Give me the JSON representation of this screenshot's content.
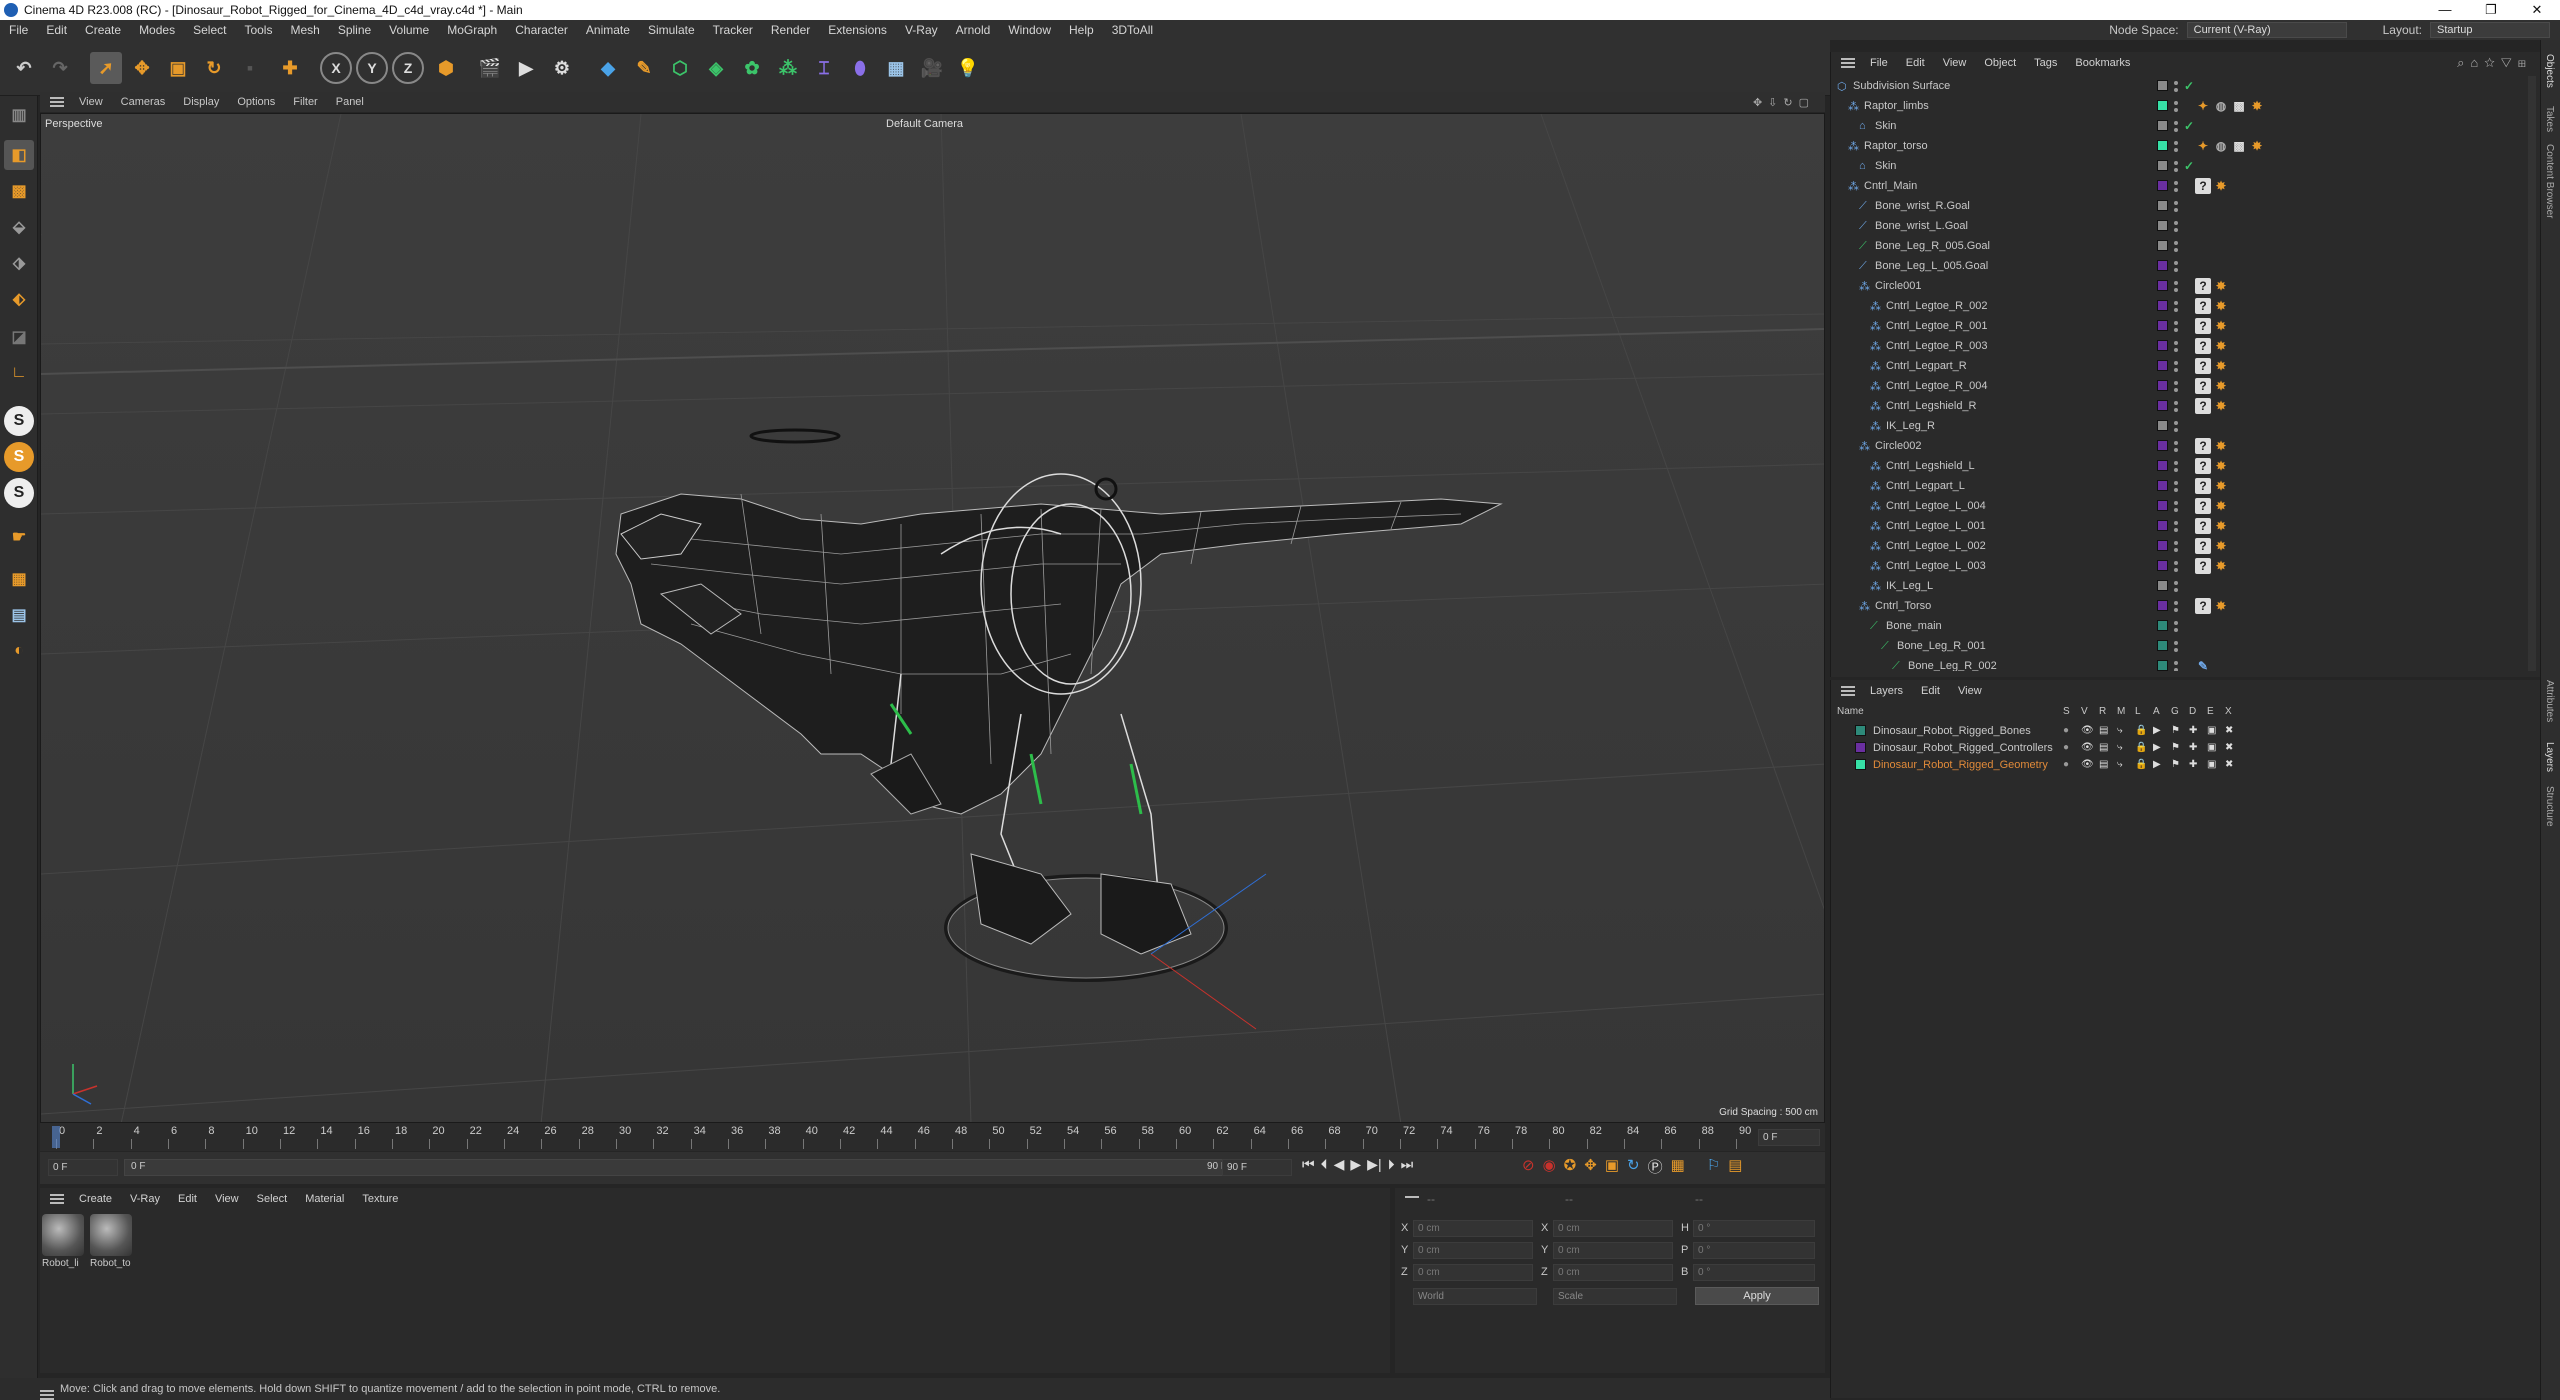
{
  "window": {
    "title": "Cinema 4D R23.008 (RC) - [Dinosaur_Robot_Rigged_for_Cinema_4D_c4d_vray.c4d *] - Main",
    "minimize": "—",
    "maximize": "❐",
    "close": "✕"
  },
  "menubar": {
    "items": [
      "File",
      "Edit",
      "Create",
      "Modes",
      "Select",
      "Tools",
      "Mesh",
      "Spline",
      "Volume",
      "MoGraph",
      "Character",
      "Animate",
      "Simulate",
      "Tracker",
      "Render",
      "Extensions",
      "V-Ray",
      "Arnold",
      "Window",
      "Help",
      "3DToAll"
    ],
    "node_space_label": "Node Space:",
    "node_space_value": "Current (V-Ray)",
    "layout_label": "Layout:",
    "layout_value": "Startup"
  },
  "toolbar": {
    "axis_x": "X",
    "axis_y": "Y",
    "axis_z": "Z"
  },
  "left_tools": {
    "s1": "S",
    "s2": "S",
    "s3": "S"
  },
  "viewport": {
    "menu": [
      "View",
      "Cameras",
      "Display",
      "Options",
      "Filter",
      "Panel"
    ],
    "projection": "Perspective",
    "camera": "Default Camera",
    "grid_spacing": "Grid Spacing : 500 cm"
  },
  "timeline": {
    "ticks": [
      "0",
      "2",
      "4",
      "6",
      "8",
      "10",
      "12",
      "14",
      "16",
      "18",
      "20",
      "22",
      "24",
      "26",
      "28",
      "30",
      "32",
      "34",
      "36",
      "38",
      "40",
      "42",
      "44",
      "46",
      "48",
      "50",
      "52",
      "54",
      "56",
      "58",
      "60",
      "62",
      "64",
      "66",
      "68",
      "70",
      "72",
      "74",
      "76",
      "78",
      "80",
      "82",
      "84",
      "86",
      "88",
      "90"
    ],
    "frame_end_field": "0 F"
  },
  "transport": {
    "current_frame": "0 F",
    "start_frame": "0 F",
    "end_frame_a": "90 F",
    "end_frame_b": "90 F"
  },
  "material_manager": {
    "menu": [
      "Create",
      "V-Ray",
      "Edit",
      "View",
      "Select",
      "Material",
      "Texture"
    ],
    "materials": [
      {
        "name": "Robot_li"
      },
      {
        "name": "Robot_to"
      }
    ]
  },
  "coordinates": {
    "header_dashes": [
      "--",
      "--",
      "--"
    ],
    "rows": [
      {
        "a_label": "X",
        "a_val": "0 cm",
        "b_label": "X",
        "b_val": "0 cm",
        "c_label": "H",
        "c_val": "0 °"
      },
      {
        "a_label": "Y",
        "a_val": "0 cm",
        "b_label": "Y",
        "b_val": "0 cm",
        "c_label": "P",
        "c_val": "0 °"
      },
      {
        "a_label": "Z",
        "a_val": "0 cm",
        "b_label": "Z",
        "b_val": "0 cm",
        "c_label": "B",
        "c_val": "0 °"
      }
    ],
    "space": "World",
    "mode": "Scale",
    "apply": "Apply"
  },
  "status": "Move: Click and drag to move elements. Hold down SHIFT to quantize movement / add to the selection in point mode, CTRL to remove.",
  "object_manager": {
    "menu": [
      "File",
      "Edit",
      "View",
      "Object",
      "Tags",
      "Bookmarks"
    ],
    "objects": [
      {
        "name": "Subdivision Surface",
        "indent": 0,
        "color": "#8a8a8a",
        "tags": "check"
      },
      {
        "name": "Raptor_limbs",
        "indent": 1,
        "color": "#37e0a6",
        "tags": "mat"
      },
      {
        "name": "Skin",
        "indent": 2,
        "color": "#8a8a8a",
        "tags": "check"
      },
      {
        "name": "Raptor_torso",
        "indent": 1,
        "color": "#37e0a6",
        "tags": "mat"
      },
      {
        "name": "Skin",
        "indent": 2,
        "color": "#8a8a8a",
        "tags": "check"
      },
      {
        "name": "Cntrl_Main",
        "indent": 1,
        "color": "#6a2fa0",
        "tags": "ik"
      },
      {
        "name": "Bone_wrist_R.Goal",
        "indent": 2,
        "color": "#8a8a8a",
        "tags": ""
      },
      {
        "name": "Bone_wrist_L.Goal",
        "indent": 2,
        "color": "#8a8a8a",
        "tags": ""
      },
      {
        "name": "Bone_Leg_R_005.Goal",
        "indent": 2,
        "color": "#8a8a8a",
        "tags": ""
      },
      {
        "name": "Bone_Leg_L_005.Goal",
        "indent": 2,
        "color": "#6a2fa0",
        "tags": ""
      },
      {
        "name": "Circle001",
        "indent": 2,
        "color": "#6a2fa0",
        "tags": "ik"
      },
      {
        "name": "Cntrl_Legtoe_R_002",
        "indent": 3,
        "color": "#6a2fa0",
        "tags": "ik"
      },
      {
        "name": "Cntrl_Legtoe_R_001",
        "indent": 3,
        "color": "#6a2fa0",
        "tags": "ik"
      },
      {
        "name": "Cntrl_Legtoe_R_003",
        "indent": 3,
        "color": "#6a2fa0",
        "tags": "ik"
      },
      {
        "name": "Cntrl_Legpart_R",
        "indent": 3,
        "color": "#6a2fa0",
        "tags": "ik"
      },
      {
        "name": "Cntrl_Legtoe_R_004",
        "indent": 3,
        "color": "#6a2fa0",
        "tags": "ik"
      },
      {
        "name": "Cntrl_Legshield_R",
        "indent": 3,
        "color": "#6a2fa0",
        "tags": "ik"
      },
      {
        "name": "IK_Leg_R",
        "indent": 3,
        "color": "#8a8a8a",
        "tags": ""
      },
      {
        "name": "Circle002",
        "indent": 2,
        "color": "#6a2fa0",
        "tags": "ik"
      },
      {
        "name": "Cntrl_Legshield_L",
        "indent": 3,
        "color": "#6a2fa0",
        "tags": "ik"
      },
      {
        "name": "Cntrl_Legpart_L",
        "indent": 3,
        "color": "#6a2fa0",
        "tags": "ik"
      },
      {
        "name": "Cntrl_Legtoe_L_004",
        "indent": 3,
        "color": "#6a2fa0",
        "tags": "ik"
      },
      {
        "name": "Cntrl_Legtoe_L_001",
        "indent": 3,
        "color": "#6a2fa0",
        "tags": "ik"
      },
      {
        "name": "Cntrl_Legtoe_L_002",
        "indent": 3,
        "color": "#6a2fa0",
        "tags": "ik"
      },
      {
        "name": "Cntrl_Legtoe_L_003",
        "indent": 3,
        "color": "#6a2fa0",
        "tags": "ik"
      },
      {
        "name": "IK_Leg_L",
        "indent": 3,
        "color": "#8a8a8a",
        "tags": ""
      },
      {
        "name": "Cntrl_Torso",
        "indent": 2,
        "color": "#6a2fa0",
        "tags": "ik"
      },
      {
        "name": "Bone_main",
        "indent": 3,
        "color": "#2e8a7a",
        "tags": ""
      },
      {
        "name": "Bone_Leg_R_001",
        "indent": 4,
        "color": "#2e8a7a",
        "tags": ""
      },
      {
        "name": "Bone_Leg_R_002",
        "indent": 5,
        "color": "#2e8a7a",
        "tags": "pen"
      }
    ]
  },
  "layers_manager": {
    "menu": [
      "Layers",
      "Edit",
      "View"
    ],
    "col_name": "Name",
    "cols": [
      "S",
      "V",
      "R",
      "M",
      "L",
      "A",
      "G",
      "D",
      "E",
      "X"
    ],
    "layers": [
      {
        "name": "Dinosaur_Robot_Rigged_Bones",
        "color": "#2e8a7a",
        "text_color": "#c8c8c8"
      },
      {
        "name": "Dinosaur_Robot_Rigged_Controllers",
        "color": "#6a2fa0",
        "text_color": "#c8c8c8"
      },
      {
        "name": "Dinosaur_Robot_Rigged_Geometry",
        "color": "#37e0a6",
        "text_color": "#e08a3a"
      }
    ]
  },
  "right_tabs": [
    "Objects",
    "Takes",
    "Content Browser",
    "Attributes",
    "Layers",
    "Structure"
  ]
}
